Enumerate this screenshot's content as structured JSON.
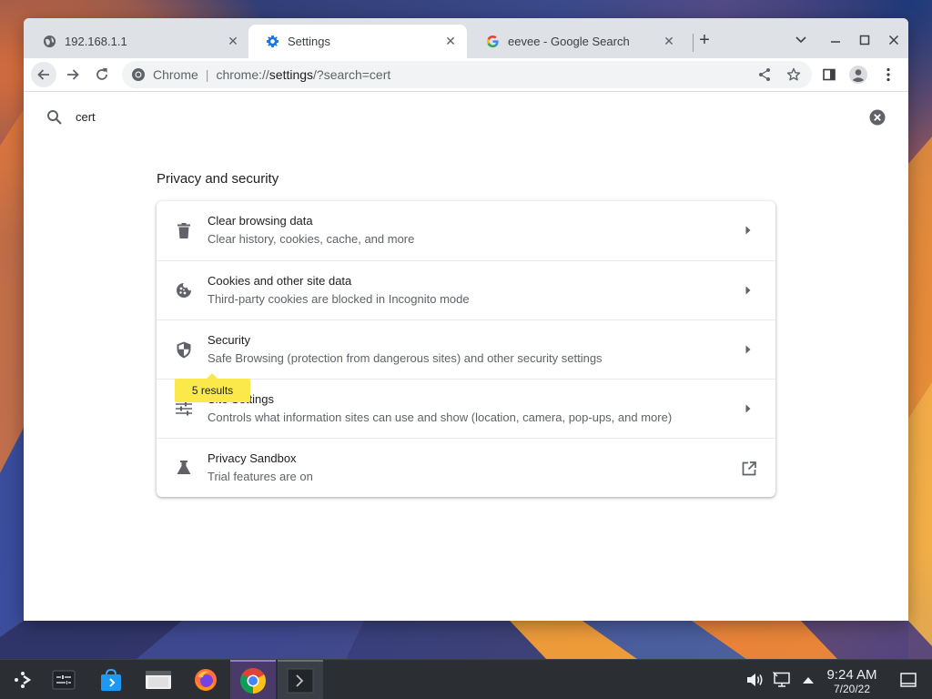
{
  "browser": {
    "tabs": [
      {
        "title": "192.168.1.1",
        "icon": "globe-icon",
        "active": false
      },
      {
        "title": "Settings",
        "icon": "gear-icon",
        "active": true
      },
      {
        "title": "eevee - Google Search",
        "icon": "google-icon",
        "active": false
      }
    ],
    "omnibox": {
      "site_label": "Chrome",
      "separator": "|",
      "url_prefix": "chrome://",
      "url_host": "settings",
      "url_path": "/?search=cert"
    }
  },
  "settings": {
    "search_query": "cert",
    "section_title": "Privacy and security",
    "rows": [
      {
        "title": "Clear browsing data",
        "subtitle": "Clear history, cookies, cache, and more",
        "icon": "trash-icon",
        "action": "arrow"
      },
      {
        "title": "Cookies and other site data",
        "subtitle": "Third-party cookies are blocked in Incognito mode",
        "icon": "cookie-icon",
        "action": "arrow"
      },
      {
        "title": "Security",
        "subtitle": "Safe Browsing (protection from dangerous sites) and other security settings",
        "icon": "shield-icon",
        "action": "arrow"
      },
      {
        "title": "Site Settings",
        "subtitle": "Controls what information sites can use and show (location, camera, pop-ups, and more)",
        "icon": "tune-icon",
        "action": "arrow"
      },
      {
        "title": "Privacy Sandbox",
        "subtitle": "Trial features are on",
        "icon": "flask-icon",
        "action": "external-link"
      }
    ],
    "results_bubble": "5 results"
  },
  "taskbar": {
    "apps": [
      "app-launcher-icon",
      "system-settings-icon",
      "discover-store-icon",
      "file-manager-icon",
      "firefox-icon",
      "chrome-icon",
      "terminal-icon"
    ],
    "clock_time": "9:24 AM",
    "clock_date": "7/20/22"
  },
  "colors": {
    "bubble": "#fbe84b",
    "tabstrip": "#dee1e6",
    "taskbar": "#2b2e33"
  }
}
